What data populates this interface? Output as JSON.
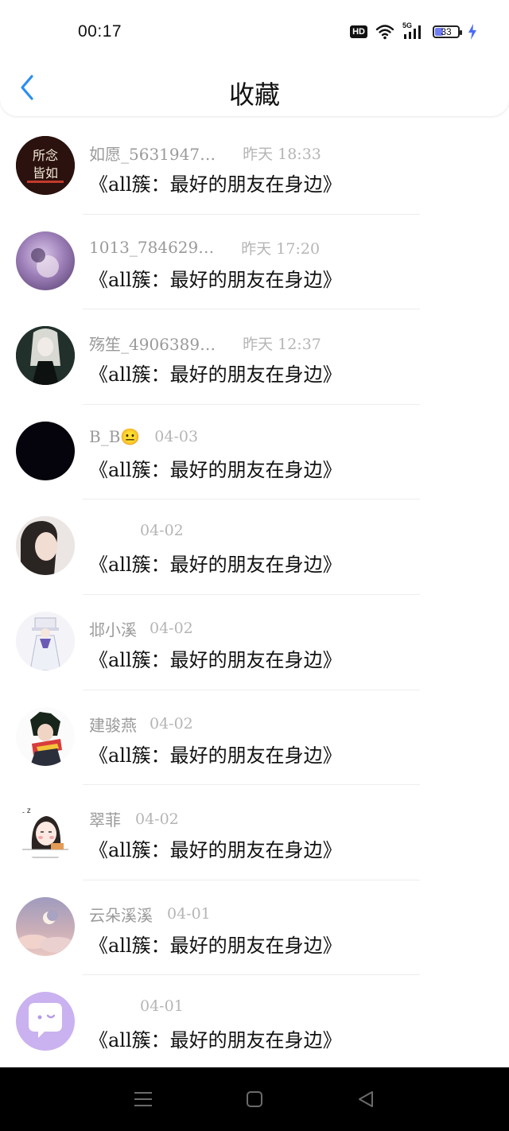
{
  "status_bar": {
    "time": "00:17",
    "hd_label": "HD",
    "network_label": "5G",
    "battery_level": "33",
    "charging": true
  },
  "header": {
    "title": "收藏",
    "back_icon": "chevron-left-icon"
  },
  "colors": {
    "accent": "#2b8ef0",
    "battery_fill": "#6f7cf5",
    "charge": "#4a6cf7"
  },
  "favorites": [
    {
      "name": "如愿_5631947…",
      "date": "昨天 18:33",
      "message": "《all簇：最好的朋友在身边》",
      "avatar": "dark-calligraphy-avatar"
    },
    {
      "name": "1013_784629…",
      "date": "昨天 17:20",
      "message": "《all簇：最好的朋友在身边》",
      "avatar": "purple-photo-avatar"
    },
    {
      "name": "殇笙_4906389…",
      "date": "昨天 12:37",
      "message": "《all簇：最好的朋友在身边》",
      "avatar": "anime-dark-avatar"
    },
    {
      "name": "B_B😐",
      "date": "04-03",
      "message": "《all簇：最好的朋友在身边》",
      "avatar": "black-avatar"
    },
    {
      "name": "",
      "date": "04-02",
      "message": "《all簇：最好的朋友在身边》",
      "avatar": "girl-photo-avatar"
    },
    {
      "name": "邶小溪",
      "date": "04-02",
      "message": "《all簇：最好的朋友在身边》",
      "avatar": "white-character-avatar"
    },
    {
      "name": "建骏燕",
      "date": "04-02",
      "message": "《all簇：最好的朋友在身边》",
      "avatar": "scarf-character-avatar"
    },
    {
      "name": "翠菲",
      "date": "04-02",
      "message": "《all簇：最好的朋友在身边》",
      "avatar": "sketch-girl-avatar"
    },
    {
      "name": "云朵溪溪",
      "date": "04-01",
      "message": "《all簇：最好的朋友在身边》",
      "avatar": "moon-sky-avatar"
    },
    {
      "name": "",
      "date": "04-01",
      "message": "《all簇：最好的朋友在身边》",
      "avatar": "chat-bubble-avatar"
    }
  ],
  "nav_bar": {
    "menu_icon": "menu-icon",
    "home_icon": "square-home-icon",
    "back_icon": "triangle-back-icon"
  }
}
